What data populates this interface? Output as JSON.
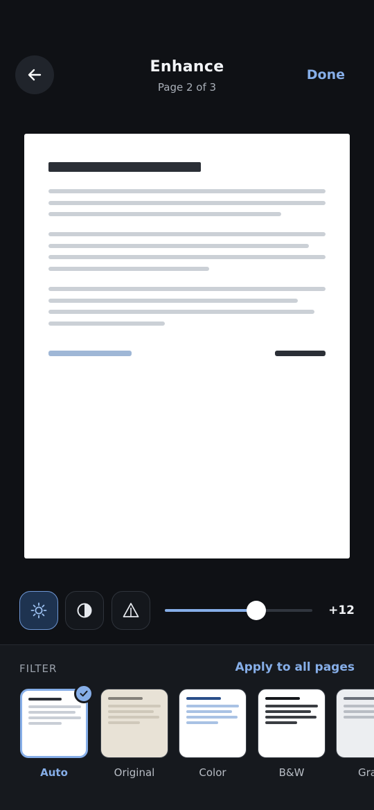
{
  "header": {
    "title": "Enhance",
    "subtitle": "Page 2 of 3",
    "done_label": "Done",
    "back_icon": "arrow-left-icon"
  },
  "adjust": {
    "tools": [
      {
        "name": "brightness",
        "icon": "sun-icon",
        "active": true
      },
      {
        "name": "contrast",
        "icon": "contrast-icon",
        "active": false
      },
      {
        "name": "sharpness",
        "icon": "triangle-icon",
        "active": false
      }
    ],
    "slider_fraction": 0.62,
    "value_label": "+12"
  },
  "filter": {
    "section_label": "FILTER",
    "apply_all_label": "Apply to all pages",
    "options": [
      {
        "label": "Auto",
        "selected": true
      },
      {
        "label": "Original",
        "selected": false
      },
      {
        "label": "Color",
        "selected": false
      },
      {
        "label": "B&W",
        "selected": false
      },
      {
        "label": "Gra",
        "selected": false
      }
    ]
  },
  "colors": {
    "accent": "#86aee8",
    "background": "#0f1115",
    "panel": "#16191e"
  }
}
